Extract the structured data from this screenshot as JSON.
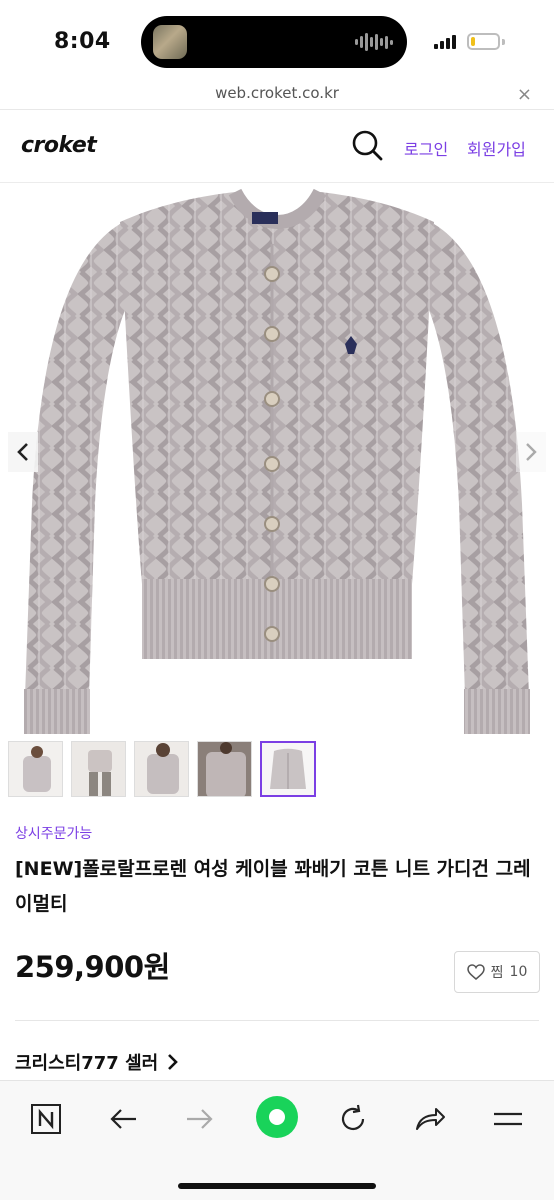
{
  "status_bar": {
    "time": "8:04",
    "battery_level": 0.15
  },
  "browser": {
    "url": "web.croket.co.kr",
    "close_icon": "×"
  },
  "header": {
    "logo": "croket",
    "login": "로그인",
    "signup": "회원가입"
  },
  "gallery": {
    "image_count": 5,
    "active_index": 4
  },
  "product": {
    "availability": "상시주문가능",
    "title": "[NEW]폴로랄프로렌 여성 케이블 꽈배기 코튼 니트 가디건 그레이멀티",
    "price": "259,900원",
    "wish_label": "찜",
    "wish_count": "10"
  },
  "seller": {
    "name": "크리스티777 셀러"
  },
  "colors": {
    "accent": "#7b3fe4",
    "green": "#19d35a"
  }
}
